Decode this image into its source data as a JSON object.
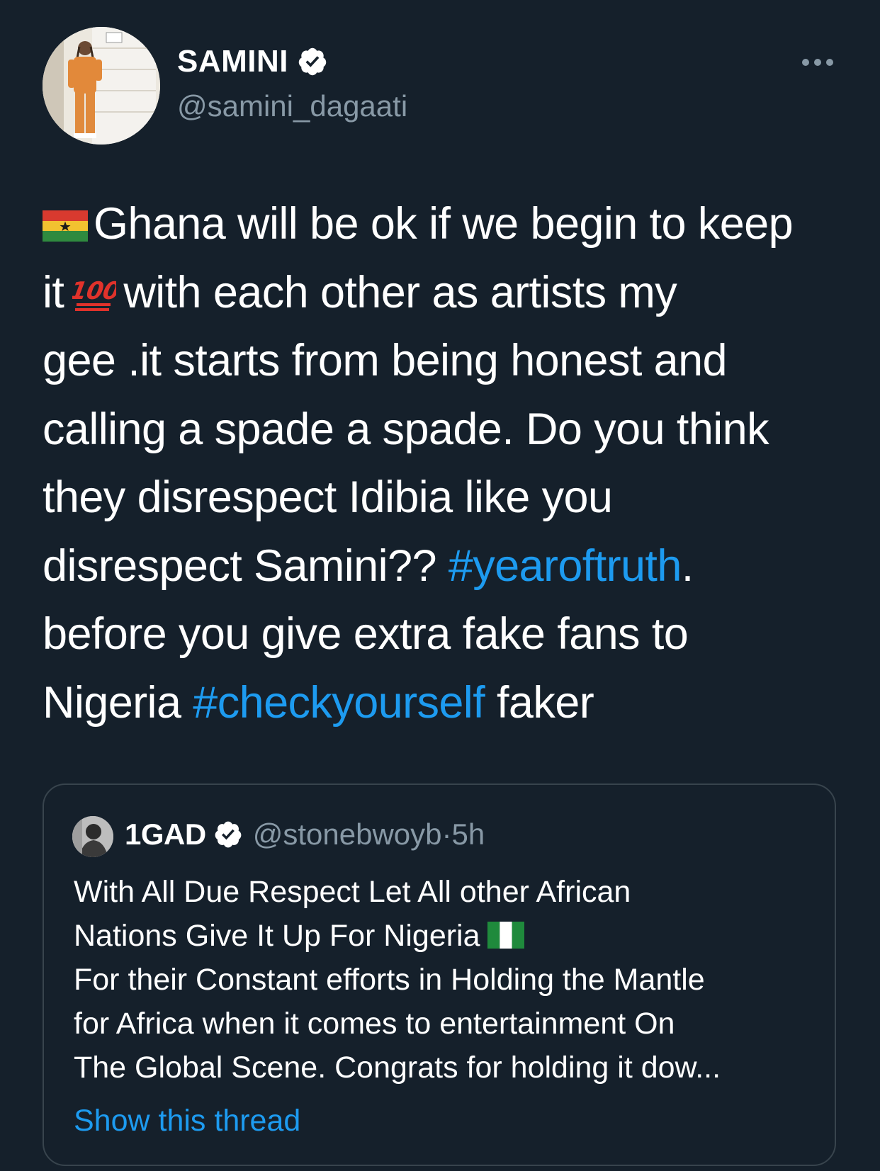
{
  "author": {
    "name": "SAMINI",
    "handle": "@samini_dagaati",
    "verified": true
  },
  "tweet": {
    "lines": [
      {
        "before": "Ghana will be ok if we begin to keep"
      },
      {
        "before": "it",
        "after": "with each other as artists my"
      },
      {
        "before": "gee .it starts from being honest and"
      },
      {
        "before": "calling a spade a spade. Do you think"
      },
      {
        "before": "they disrespect Idibia like you"
      },
      {
        "before": "disrespect Samini?? ",
        "hashtag": "#yearoftruth",
        "after": "."
      },
      {
        "before": "before you give extra fake fans to"
      },
      {
        "before": "Nigeria ",
        "hashtag": "#checkyourself",
        "after": " faker"
      }
    ],
    "emoji": {
      "flag_start": "ghana-flag-icon",
      "inline": "hundred-points-icon"
    }
  },
  "quoted": {
    "name": "1GAD",
    "verified": true,
    "handle": "@stonebwoyb",
    "time": "5h",
    "separator": " · ",
    "lines": [
      "With All Due Respect Let All other African",
      "Nations  Give It Up For Nigeria",
      "For their Constant efforts in Holding the Mantle",
      "for Africa when it comes to entertainment On",
      "The Global Scene. Congrats for holding it dow..."
    ],
    "flag": "nigeria-flag-icon",
    "show_thread": "Show this thread"
  },
  "colors": {
    "background": "#15202b",
    "text": "#ffffff",
    "muted": "#8899a6",
    "link": "#1d9bf0",
    "border": "#38444d"
  }
}
